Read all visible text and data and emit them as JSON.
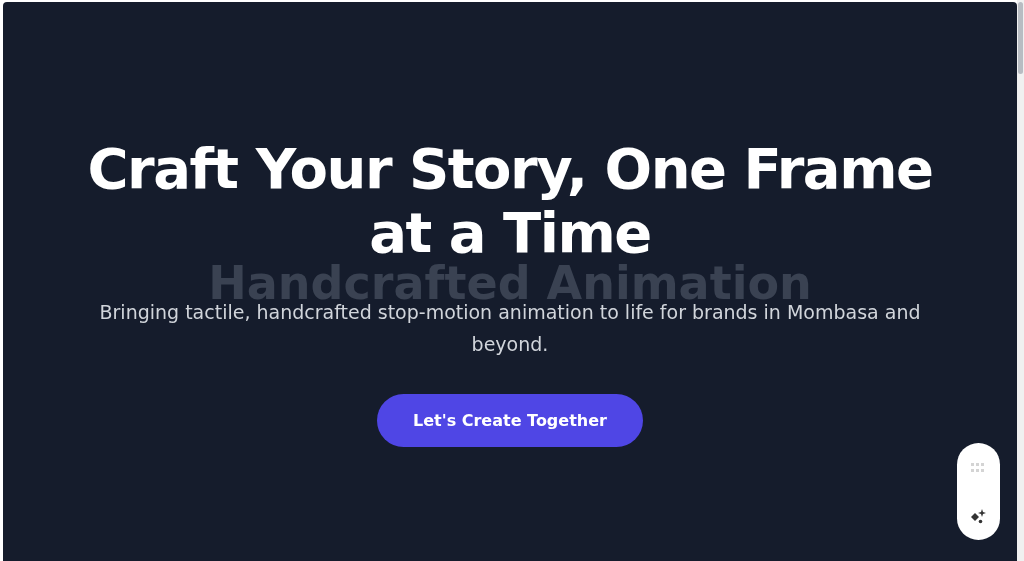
{
  "hero": {
    "title": "Craft Your Story, One Frame at a Time",
    "background_text": "Handcrafted Animation",
    "subtitle": "Bringing tactile, handcrafted stop-motion animation to life for brands in Mombasa and beyond.",
    "cta": "Let's Create Together"
  }
}
